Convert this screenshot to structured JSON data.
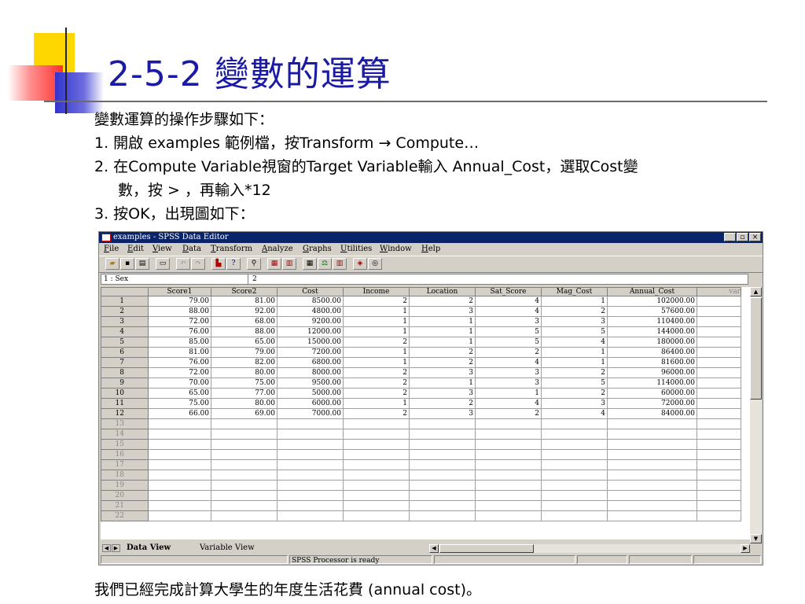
{
  "slide": {
    "title": "2-5-2 變數的運算",
    "lines": [
      "變數運算的操作步驟如下：",
      "1. 開啟 examples 範例檔，按Transform → Compute…",
      "2. 在Compute Variable視窗的Target Variable輸入 Annual_Cost，選取Cost變",
      "數，按 > ，再輸入*12",
      "3. 按OK，出現圖如下："
    ],
    "caption": "我們已經完成計算大學生的年度生活花費 (annual cost)。",
    "colors": {
      "title": "#1a1aa6",
      "deco_yellow": "#ffd700",
      "deco_red": "#ff3030",
      "deco_blue": "#3333cc"
    }
  },
  "window": {
    "title": "examples - SPSS Data Editor",
    "controls": [
      "_",
      "▫",
      "×"
    ],
    "menu": [
      "File",
      "Edit",
      "View",
      "Data",
      "Transform",
      "Analyze",
      "Graphs",
      "Utilities",
      "Window",
      "Help"
    ],
    "cell_ref": "1 : Sex",
    "cell_value": "2",
    "columns": [
      "Score1",
      "Score2",
      "Cost",
      "Income",
      "Location",
      "Sat_Score",
      "Mag_Cost",
      "Annual_Cost",
      "var"
    ],
    "rows": [
      [
        "1",
        "79.00",
        "81.00",
        "8500.00",
        "2",
        "2",
        "4",
        "1",
        "102000.00"
      ],
      [
        "2",
        "88.00",
        "92.00",
        "4800.00",
        "1",
        "3",
        "4",
        "2",
        "57600.00"
      ],
      [
        "3",
        "72.00",
        "68.00",
        "9200.00",
        "1",
        "1",
        "3",
        "3",
        "110400.00"
      ],
      [
        "4",
        "76.00",
        "88.00",
        "12000.00",
        "1",
        "1",
        "5",
        "5",
        "144000.00"
      ],
      [
        "5",
        "85.00",
        "65.00",
        "15000.00",
        "2",
        "1",
        "5",
        "4",
        "180000.00"
      ],
      [
        "6",
        "81.00",
        "79.00",
        "7200.00",
        "1",
        "2",
        "2",
        "1",
        "86400.00"
      ],
      [
        "7",
        "76.00",
        "82.00",
        "6800.00",
        "1",
        "2",
        "4",
        "1",
        "81600.00"
      ],
      [
        "8",
        "72.00",
        "80.00",
        "8000.00",
        "2",
        "3",
        "3",
        "2",
        "96000.00"
      ],
      [
        "9",
        "70.00",
        "75.00",
        "9500.00",
        "2",
        "1",
        "3",
        "5",
        "114000.00"
      ],
      [
        "10",
        "65.00",
        "77.00",
        "5000.00",
        "2",
        "3",
        "1",
        "2",
        "60000.00"
      ],
      [
        "11",
        "75.00",
        "80.00",
        "6000.00",
        "1",
        "2",
        "4",
        "3",
        "72000.00"
      ],
      [
        "12",
        "66.00",
        "69.00",
        "7000.00",
        "2",
        "3",
        "2",
        "4",
        "84000.00"
      ]
    ],
    "empty_rows": [
      "13",
      "14",
      "15",
      "16",
      "17",
      "18",
      "19",
      "20",
      "21",
      "22"
    ],
    "tabs": {
      "active": "Data View",
      "inactive": "Variable View"
    },
    "status": "SPSS Processor  is ready"
  }
}
